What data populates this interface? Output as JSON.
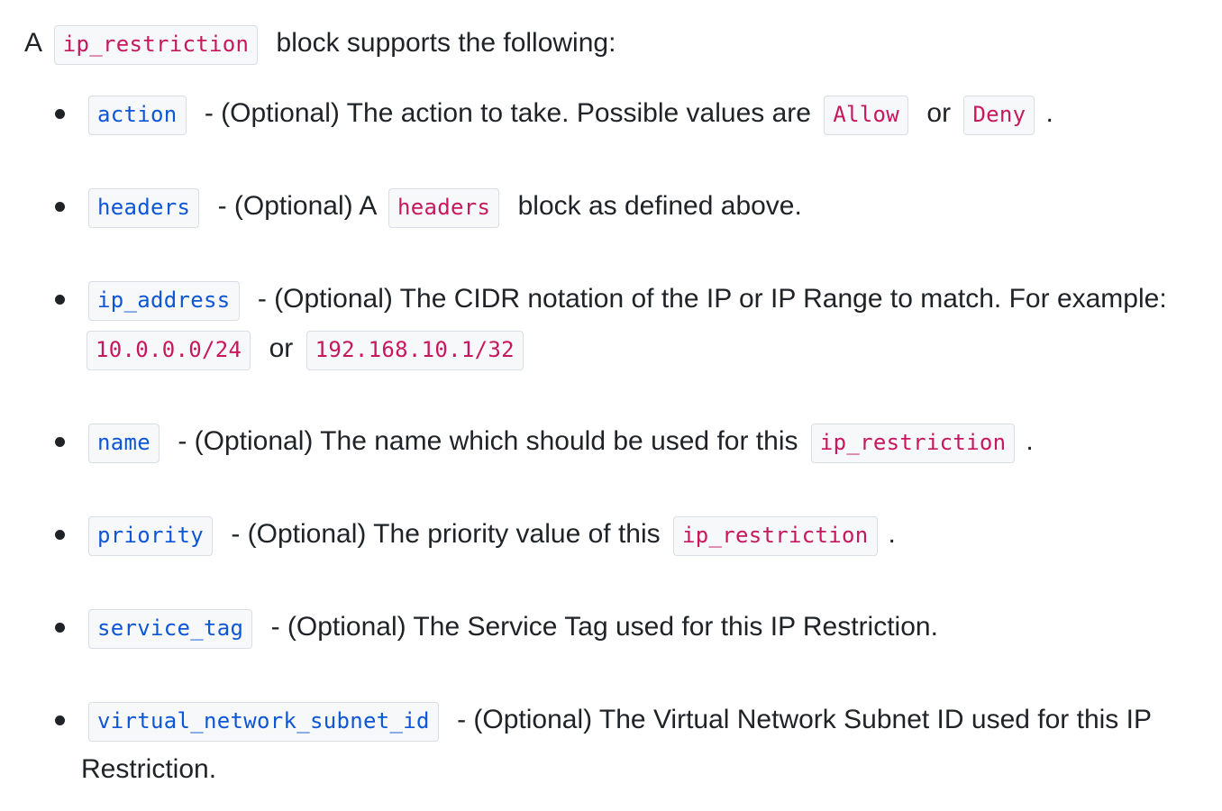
{
  "intro": {
    "prefix": "A",
    "code": "ip_restriction",
    "suffix": "block supports the following:"
  },
  "items": [
    {
      "arg": "action",
      "text1": "- (Optional) The action to take. Possible values are",
      "code1": "Allow",
      "text2": "or",
      "code2": "Deny",
      "text3": "."
    },
    {
      "arg": "headers",
      "text1": "- (Optional) A",
      "code1": "headers",
      "text2": "block as defined above."
    },
    {
      "arg": "ip_address",
      "text1": "- (Optional) The CIDR notation of the IP or IP Range to match. For example:",
      "code1": "10.0.0.0/24",
      "text2": "or",
      "code2": "192.168.10.1/32"
    },
    {
      "arg": "name",
      "text1": "- (Optional) The name which should be used for this",
      "code1": "ip_restriction",
      "text2": "."
    },
    {
      "arg": "priority",
      "text1": "- (Optional) The priority value of this",
      "code1": "ip_restriction",
      "text2": "."
    },
    {
      "arg": "service_tag",
      "text1": "- (Optional) The Service Tag used for this IP Restriction."
    },
    {
      "arg": "virtual_network_subnet_id",
      "text1": "- (Optional) The Virtual Network Subnet ID used for this IP Restriction."
    }
  ],
  "colors": {
    "text": "#1f2328",
    "argument_code": "#0d56d6",
    "reference_code": "#c7185f",
    "code_background": "#f6f8fa",
    "code_border": "#d8dee4"
  }
}
